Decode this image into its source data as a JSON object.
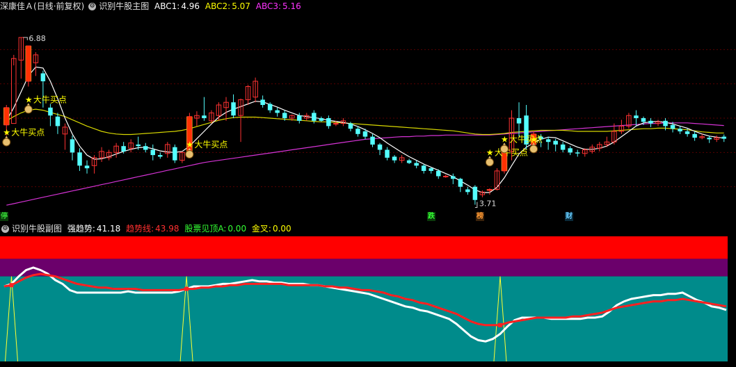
{
  "main_header": {
    "stock": "深康佳Ａ",
    "period": "(日线·前复权)",
    "indicator": "识别牛股主图",
    "abc1_label": "ABC1:",
    "abc1_value": "4.96",
    "abc2_label": "ABC2:",
    "abc2_value": "5.07",
    "abc3_label": "ABC3:",
    "abc3_value": "5.16",
    "colors": {
      "abc1": "#ffffff",
      "abc2": "#ffff00",
      "abc3": "#ff33ff"
    }
  },
  "sub_header": {
    "indicator": "识别牛股副图",
    "strong_label": "强趋势:",
    "strong_value": "41.18",
    "trend_label": "趋势线:",
    "trend_value": "43.98",
    "top_label": "股票见顶A:",
    "top_value": "0.00",
    "cross_label": "金叉:",
    "cross_value": "0.00"
  },
  "event_tags": [
    {
      "text": "停",
      "color": "#33cc33",
      "bg": "#0a3a0a"
    },
    {
      "text": "跌",
      "color": "#33ff33",
      "bg": "#0a3a0a"
    },
    {
      "text": "榜",
      "color": "#ff9933",
      "bg": "#3a220a"
    },
    {
      "text": "财",
      "color": "#66ccff",
      "bg": "#0a2a3a"
    }
  ],
  "chart_data": [
    {
      "type": "candlestick",
      "title": "识别牛股主图",
      "ylim": [
        3.4,
        7.3
      ],
      "high_label": "6.88",
      "low_label": "3.71",
      "signal_label": "大牛买点",
      "signal_icon": "money-bag-icon",
      "candles": [
        [
          5.22,
          5.55,
          5.02,
          5.6
        ],
        [
          5.25,
          6.48,
          6.35,
          6.55
        ],
        [
          6.45,
          6.88,
          6.1,
          6.88
        ],
        [
          6.05,
          6.72,
          5.95,
          6.72
        ],
        [
          6.4,
          6.55,
          6.15,
          6.6
        ],
        [
          6.2,
          6.05,
          5.55,
          6.25
        ],
        [
          5.55,
          5.4,
          5.2,
          5.62
        ],
        [
          5.38,
          5.2,
          5.05,
          5.45
        ],
        [
          5.05,
          5.18,
          4.75,
          5.25
        ],
        [
          4.95,
          4.7,
          4.55,
          5.02
        ],
        [
          4.7,
          4.45,
          4.35,
          4.78
        ],
        [
          4.45,
          4.4,
          4.3,
          4.55
        ],
        [
          4.45,
          4.6,
          4.3,
          4.65
        ],
        [
          4.6,
          4.72,
          4.52,
          4.8
        ],
        [
          4.6,
          4.7,
          4.55,
          4.75
        ],
        [
          4.7,
          4.82,
          4.6,
          4.88
        ],
        [
          4.82,
          4.72,
          4.68,
          4.9
        ],
        [
          4.78,
          4.88,
          4.7,
          4.95
        ],
        [
          4.85,
          4.82,
          4.75,
          5.0
        ],
        [
          4.82,
          4.75,
          4.7,
          4.88
        ],
        [
          4.75,
          4.65,
          4.55,
          4.85
        ],
        [
          4.65,
          4.62,
          4.58,
          4.7
        ],
        [
          4.68,
          4.85,
          4.6,
          4.9
        ],
        [
          4.8,
          4.55,
          4.5,
          4.85
        ],
        [
          4.55,
          4.7,
          4.5,
          4.72
        ],
        [
          4.7,
          5.38,
          4.68,
          5.45
        ],
        [
          5.35,
          5.4,
          5.2,
          5.48
        ],
        [
          5.4,
          5.35,
          5.3,
          5.75
        ],
        [
          5.3,
          5.45,
          5.25,
          5.5
        ],
        [
          5.4,
          5.6,
          5.3,
          5.65
        ],
        [
          5.55,
          5.65,
          5.3,
          5.75
        ],
        [
          5.65,
          5.4,
          5.35,
          5.8
        ],
        [
          5.4,
          5.7,
          4.9,
          5.72
        ],
        [
          5.7,
          5.95,
          5.6,
          5.98
        ],
        [
          5.75,
          6.05,
          5.65,
          6.12
        ],
        [
          5.7,
          5.6,
          5.55,
          5.78
        ],
        [
          5.62,
          5.5,
          5.45,
          5.65
        ],
        [
          5.5,
          5.45,
          5.38,
          5.55
        ],
        [
          5.45,
          5.35,
          5.3,
          5.5
        ],
        [
          5.35,
          5.4,
          5.3,
          5.42
        ],
        [
          5.4,
          5.3,
          5.25,
          5.45
        ],
        [
          5.35,
          5.4,
          5.3,
          5.45
        ],
        [
          5.45,
          5.3,
          5.25,
          5.5
        ],
        [
          5.35,
          5.3,
          5.28,
          5.38
        ],
        [
          5.35,
          5.2,
          5.15,
          5.4
        ],
        [
          5.25,
          5.25,
          5.2,
          5.3
        ],
        [
          5.25,
          5.3,
          5.2,
          5.35
        ],
        [
          5.25,
          5.15,
          5.1,
          5.28
        ],
        [
          5.15,
          5.05,
          5.0,
          5.2
        ],
        [
          5.1,
          5.0,
          4.95,
          5.15
        ],
        [
          5.0,
          4.85,
          4.8,
          5.05
        ],
        [
          4.85,
          4.75,
          4.65,
          4.88
        ],
        [
          4.75,
          4.6,
          4.55,
          4.8
        ],
        [
          4.62,
          4.55,
          4.5,
          4.65
        ],
        [
          4.55,
          4.6,
          4.5,
          4.65
        ],
        [
          4.55,
          4.5,
          4.48,
          4.58
        ],
        [
          4.5,
          4.45,
          4.4,
          4.55
        ],
        [
          4.45,
          4.35,
          4.3,
          4.48
        ],
        [
          4.4,
          4.35,
          4.3,
          4.42
        ],
        [
          4.35,
          4.25,
          4.2,
          4.38
        ],
        [
          4.25,
          4.25,
          4.22,
          4.28
        ],
        [
          4.25,
          4.2,
          4.1,
          4.3
        ],
        [
          4.2,
          4.05,
          3.95,
          4.22
        ],
        [
          4.0,
          3.95,
          3.9,
          4.05
        ],
        [
          4.05,
          3.8,
          3.71,
          4.08
        ],
        [
          3.9,
          3.95,
          3.85,
          3.98
        ],
        [
          3.98,
          4.0,
          3.9,
          4.02
        ],
        [
          4.0,
          4.35,
          3.98,
          4.4
        ],
        [
          4.35,
          4.72,
          4.3,
          4.8
        ],
        [
          4.72,
          5.35,
          4.55,
          5.5
        ],
        [
          5.35,
          5.25,
          5.0,
          5.65
        ],
        [
          5.4,
          4.85,
          4.75,
          5.6
        ],
        [
          4.85,
          5.05,
          4.8,
          5.1
        ],
        [
          5.0,
          4.95,
          4.8,
          5.05
        ],
        [
          4.95,
          4.9,
          4.75,
          5.0
        ],
        [
          4.92,
          4.85,
          4.72,
          4.96
        ],
        [
          4.85,
          4.75,
          4.7,
          4.9
        ],
        [
          4.78,
          4.7,
          4.65,
          4.82
        ],
        [
          4.7,
          4.68,
          4.62,
          4.75
        ],
        [
          4.68,
          4.75,
          4.62,
          4.78
        ],
        [
          4.72,
          4.8,
          4.68,
          4.85
        ],
        [
          4.78,
          4.85,
          4.72,
          4.9
        ],
        [
          4.85,
          4.9,
          4.8,
          5.0
        ],
        [
          4.9,
          5.1,
          4.85,
          5.25
        ],
        [
          5.1,
          5.2,
          5.05,
          5.32
        ],
        [
          5.2,
          5.4,
          5.15,
          5.45
        ],
        [
          5.4,
          5.35,
          5.2,
          5.5
        ],
        [
          5.35,
          5.28,
          5.22,
          5.38
        ],
        [
          5.3,
          5.25,
          5.18,
          5.35
        ],
        [
          5.25,
          5.28,
          5.2,
          5.32
        ],
        [
          5.3,
          5.2,
          5.12,
          5.35
        ],
        [
          5.22,
          5.15,
          5.08,
          5.28
        ],
        [
          5.15,
          5.1,
          5.05,
          5.2
        ],
        [
          5.1,
          5.05,
          5.0,
          5.15
        ],
        [
          5.05,
          4.98,
          4.92,
          5.1
        ],
        [
          4.98,
          5.0,
          4.95,
          5.05
        ],
        [
          4.98,
          4.95,
          4.88,
          5.02
        ],
        [
          4.95,
          4.98,
          4.9,
          5.02
        ],
        [
          5.0,
          4.96,
          4.9,
          5.04
        ]
      ],
      "ma_white": [
        5.3,
        5.55,
        5.85,
        6.15,
        6.32,
        6.3,
        6.05,
        5.72,
        5.35,
        5.05,
        4.82,
        4.65,
        4.57,
        4.58,
        4.62,
        4.67,
        4.72,
        4.76,
        4.79,
        4.8,
        4.77,
        4.73,
        4.71,
        4.7,
        4.72,
        4.82,
        4.96,
        5.1,
        5.24,
        5.37,
        5.46,
        5.52,
        5.57,
        5.62,
        5.67,
        5.66,
        5.61,
        5.56,
        5.5,
        5.45,
        5.4,
        5.38,
        5.36,
        5.34,
        5.31,
        5.29,
        5.27,
        5.24,
        5.19,
        5.13,
        5.06,
        4.98,
        4.88,
        4.79,
        4.7,
        4.62,
        4.55,
        4.48,
        4.42,
        4.36,
        4.3,
        4.24,
        4.16,
        4.08,
        3.99,
        3.94,
        3.94,
        4.04,
        4.22,
        4.45,
        4.67,
        4.8,
        4.88,
        4.95,
        4.99,
        4.98,
        4.92,
        4.86,
        4.8,
        4.76,
        4.76,
        4.78,
        4.82,
        4.9,
        5.0,
        5.1,
        5.2,
        5.26,
        5.28,
        5.29,
        5.27,
        5.24,
        5.2,
        5.16,
        5.1,
        5.05,
        5.01,
        4.99,
        4.97
      ],
      "ma_yellow": [
        5.3,
        5.38,
        5.45,
        5.5,
        5.52,
        5.5,
        5.46,
        5.42,
        5.38,
        5.32,
        5.26,
        5.2,
        5.15,
        5.1,
        5.07,
        5.05,
        5.04,
        5.04,
        5.05,
        5.06,
        5.07,
        5.08,
        5.09,
        5.1,
        5.12,
        5.15,
        5.19,
        5.23,
        5.27,
        5.31,
        5.34,
        5.36,
        5.37,
        5.37,
        5.37,
        5.36,
        5.35,
        5.34,
        5.33,
        5.32,
        5.31,
        5.3,
        5.29,
        5.28,
        5.28,
        5.27,
        5.26,
        5.25,
        5.24,
        5.23,
        5.22,
        5.21,
        5.2,
        5.19,
        5.18,
        5.17,
        5.16,
        5.15,
        5.14,
        5.13,
        5.12,
        5.11,
        5.09,
        5.07,
        5.05,
        5.04,
        5.04,
        5.05,
        5.06,
        5.08,
        5.09,
        5.1,
        5.11,
        5.12,
        5.12,
        5.12,
        5.12,
        5.11,
        5.1,
        5.1,
        5.1,
        5.1,
        5.1,
        5.11,
        5.12,
        5.13,
        5.14,
        5.15,
        5.15,
        5.16,
        5.16,
        5.15,
        5.14,
        5.13,
        5.11,
        5.09,
        5.08,
        5.07,
        5.07
      ],
      "ma_magenta": [
        3.7,
        3.73,
        3.76,
        3.79,
        3.82,
        3.85,
        3.88,
        3.91,
        3.94,
        3.97,
        4.0,
        4.03,
        4.06,
        4.09,
        4.12,
        4.15,
        4.18,
        4.21,
        4.24,
        4.27,
        4.3,
        4.33,
        4.36,
        4.39,
        4.42,
        4.45,
        4.48,
        4.51,
        4.53,
        4.55,
        4.57,
        4.59,
        4.61,
        4.63,
        4.65,
        4.67,
        4.69,
        4.71,
        4.73,
        4.75,
        4.77,
        4.79,
        4.81,
        4.83,
        4.85,
        4.87,
        4.89,
        4.91,
        4.93,
        4.95,
        4.96,
        4.97,
        4.98,
        4.99,
        5.0,
        5.0,
        5.01,
        5.01,
        5.02,
        5.02,
        5.03,
        5.03,
        5.03,
        5.03,
        5.03,
        5.03,
        5.03,
        5.04,
        5.05,
        5.06,
        5.07,
        5.08,
        5.09,
        5.1,
        5.11,
        5.12,
        5.13,
        5.14,
        5.15,
        5.16,
        5.17,
        5.18,
        5.19,
        5.2,
        5.21,
        5.22,
        5.23,
        5.24,
        5.25,
        5.25,
        5.26,
        5.26,
        5.26,
        5.26,
        5.25,
        5.24,
        5.23,
        5.22,
        5.21
      ],
      "signals": [
        {
          "index": 0,
          "price": 5.08
        },
        {
          "index": 3,
          "price": 5.7
        },
        {
          "index": 25,
          "price": 4.85
        },
        {
          "index": 66,
          "price": 4.7
        },
        {
          "index": 68,
          "price": 4.95
        },
        {
          "index": 72,
          "price": 4.95
        }
      ],
      "signal_text_indices": [
        0,
        3,
        25,
        66,
        68
      ]
    },
    {
      "type": "line",
      "title": "识别牛股副图",
      "ylim": [
        0,
        100
      ],
      "bands": [
        {
          "from": 82,
          "to": 100,
          "color": "#ff0000"
        },
        {
          "from": 68,
          "to": 82,
          "color": "#6b006b"
        },
        {
          "from": 0,
          "to": 68,
          "color": "#008b8b"
        }
      ],
      "series": [
        {
          "name": "强趋势",
          "color": "#ffffff",
          "values": [
            60,
            62,
            68,
            73,
            75,
            73,
            70,
            65,
            62,
            57,
            55,
            55,
            55,
            55,
            55,
            55,
            55,
            56,
            55,
            55,
            55,
            55,
            55,
            55,
            56,
            58,
            60,
            60,
            60,
            61,
            62,
            62,
            63,
            64,
            65,
            64,
            64,
            63,
            63,
            62,
            62,
            62,
            61,
            61,
            60,
            59,
            58,
            57,
            56,
            55,
            54,
            52,
            50,
            48,
            46,
            44,
            43,
            41,
            40,
            38,
            36,
            34,
            30,
            25,
            20,
            17,
            16,
            18,
            22,
            28,
            33,
            35,
            35,
            35,
            35,
            34,
            34,
            34,
            34,
            34,
            35,
            35,
            36,
            40,
            45,
            48,
            50,
            51,
            52,
            53,
            53,
            54,
            54,
            55,
            52,
            49,
            47,
            44,
            43,
            41.18
          ]
        },
        {
          "name": "趋势线",
          "color": "#ff2020",
          "values": [
            60,
            61,
            64,
            67,
            69,
            70,
            69,
            68,
            66,
            64,
            62,
            61,
            60,
            59,
            59,
            58,
            58,
            58,
            58,
            57,
            57,
            57,
            57,
            57,
            57,
            58,
            58,
            59,
            59,
            60,
            60,
            61,
            61,
            62,
            62,
            62,
            62,
            62,
            62,
            61,
            61,
            61,
            61,
            61,
            60,
            60,
            59,
            59,
            58,
            57,
            57,
            56,
            55,
            53,
            52,
            50,
            49,
            47,
            46,
            44,
            42,
            40,
            38,
            35,
            32,
            30,
            29,
            29,
            29,
            31,
            32,
            33,
            34,
            35,
            35,
            35,
            35,
            35,
            36,
            36,
            37,
            38,
            39,
            41,
            43,
            44,
            45,
            46,
            47,
            48,
            48,
            49,
            49,
            50,
            49,
            48,
            47,
            46,
            45,
            43.98
          ]
        }
      ],
      "spike_indices": [
        1,
        25,
        68
      ],
      "spike_value": 68
    }
  ]
}
